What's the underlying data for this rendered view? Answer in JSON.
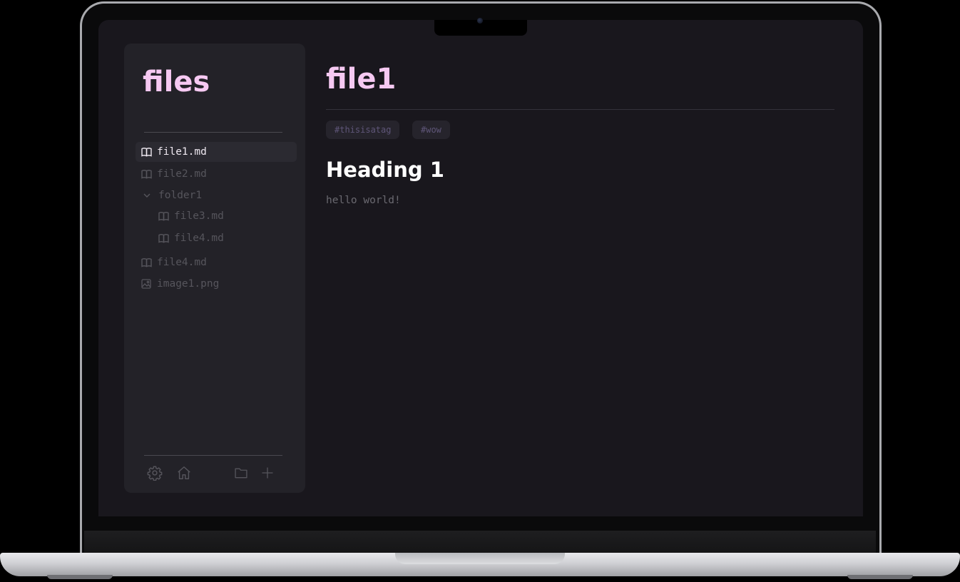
{
  "sidebar": {
    "title": "files",
    "items": [
      {
        "label": "file1.md",
        "icon": "book-icon",
        "active": true
      },
      {
        "label": "file2.md",
        "icon": "book-icon"
      },
      {
        "label": "folder1",
        "icon": "chevron-down-icon"
      },
      {
        "label": "file3.md",
        "icon": "book-icon"
      },
      {
        "label": "file4.md",
        "icon": "book-icon"
      },
      {
        "label": "file4.md",
        "icon": "book-icon"
      },
      {
        "label": "image1.png",
        "icon": "image-icon"
      }
    ],
    "footer": {
      "left": [
        "settings-icon",
        "home-icon"
      ],
      "right": [
        "folder-icon",
        "plus-icon"
      ]
    }
  },
  "main": {
    "title": "file1",
    "tags": [
      "#thisisatag",
      "#wow"
    ],
    "heading": "Heading 1",
    "paragraph": "hello world!"
  },
  "colors": {
    "accent_pink": "#f6c9f2",
    "background": "#19171d",
    "sidebar_bg": "#232228",
    "tag_text": "#5f5679"
  }
}
